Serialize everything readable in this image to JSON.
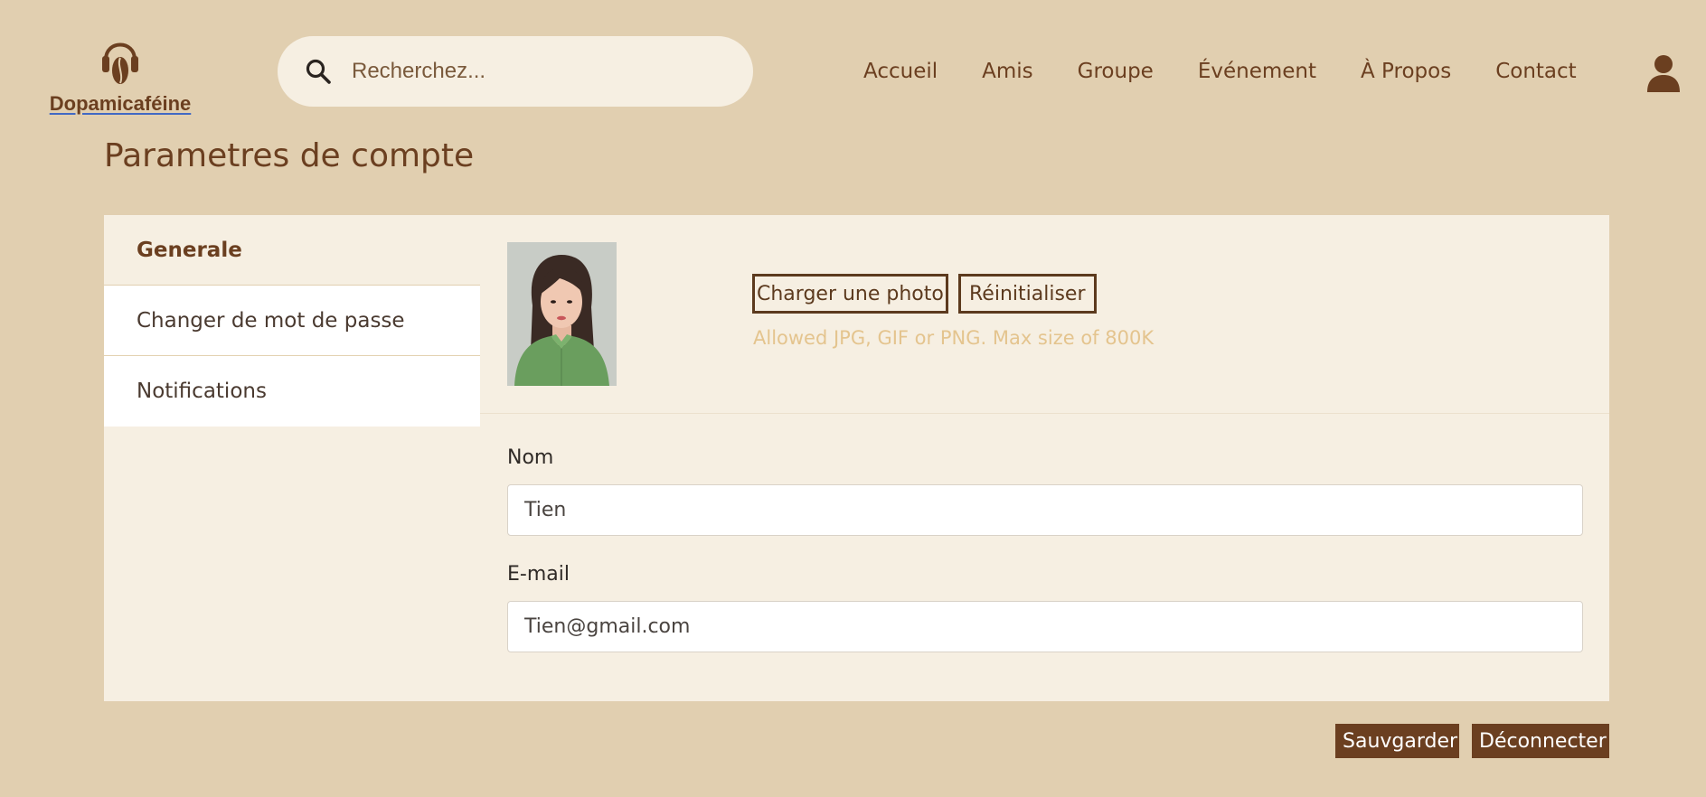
{
  "brand": {
    "name": "Dopamicaféine",
    "logo_icon": "headphones-coffee-bean-icon"
  },
  "search": {
    "placeholder": "Recherchez...",
    "value": "",
    "icon": "search-icon"
  },
  "nav": {
    "items": [
      {
        "label": "Accueil"
      },
      {
        "label": "Amis"
      },
      {
        "label": "Groupe"
      },
      {
        "label": "Événement"
      },
      {
        "label": "À Propos"
      },
      {
        "label": "Contact"
      }
    ],
    "user_icon": "user-icon"
  },
  "page": {
    "title": "Parametres de compte"
  },
  "sidebar": {
    "items": [
      {
        "label": "Generale",
        "active": true
      },
      {
        "label": "Changer de mot de passe",
        "active": false
      },
      {
        "label": "Notifications",
        "active": false
      }
    ]
  },
  "photo": {
    "upload_label": "Charger une photo",
    "reset_label": "Réinitialiser",
    "hint": "Allowed JPG, GIF or PNG. Max size of 800K"
  },
  "form": {
    "name": {
      "label": "Nom",
      "value": "Tien"
    },
    "email": {
      "label": "E-mail",
      "value": "Tien@gmail.com"
    }
  },
  "actions": {
    "save_label": "Sauvgarder",
    "logout_label": "Déconnecter"
  },
  "colors": {
    "background": "#e1cfb0",
    "card": "#f6efe2",
    "brand": "#6b3f20",
    "hint": "#e4c48e"
  }
}
